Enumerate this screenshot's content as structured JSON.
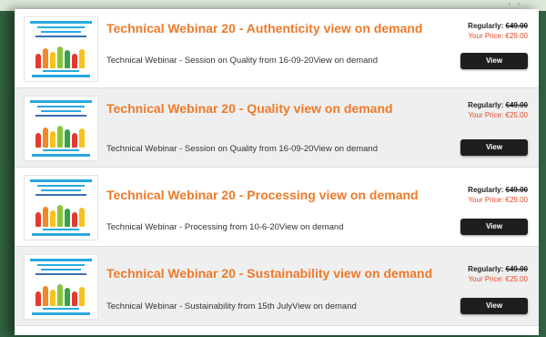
{
  "page": {
    "accent_color": "#ee7a2a",
    "price_color": "#e24a2a",
    "button_color": "#1e1e1e"
  },
  "products": [
    {
      "title": "Technical Webinar 20 - Authenticity view on demand",
      "description": "Technical Webinar - Session on Quality from 16-09-20View on demand",
      "regular_label": "Regularly:",
      "regular_price": "€49.00",
      "your_price_label": "Your Price:",
      "your_price": "€29.00",
      "button_label": "View",
      "thumbnail_icon": "webinar-thumbnail"
    },
    {
      "title": "Technical Webinar 20 - Quality view on demand",
      "description": "Technical Webinar - Session on Quality from 16-09-20View on demand",
      "regular_label": "Regularly:",
      "regular_price": "€49.00",
      "your_price_label": "Your Price:",
      "your_price": "€25.00",
      "button_label": "View",
      "thumbnail_icon": "webinar-thumbnail"
    },
    {
      "title": "Technical Webinar 20 - Processing view on demand",
      "description": "Technical Webinar - Processing from 10-6-20View on demand",
      "regular_label": "Regularly:",
      "regular_price": "€49.00",
      "your_price_label": "Your Price:",
      "your_price": "€29.00",
      "button_label": "View",
      "thumbnail_icon": "webinar-thumbnail"
    },
    {
      "title": "Technical Webinar 20 - Sustainability view on demand",
      "description": "Technical Webinar - Sustainability from 15th JulyView on demand",
      "regular_label": "Regularly:",
      "regular_price": "€49.00",
      "your_price_label": "Your Price:",
      "your_price": "€25.00",
      "button_label": "View",
      "thumbnail_icon": "webinar-thumbnail"
    }
  ]
}
